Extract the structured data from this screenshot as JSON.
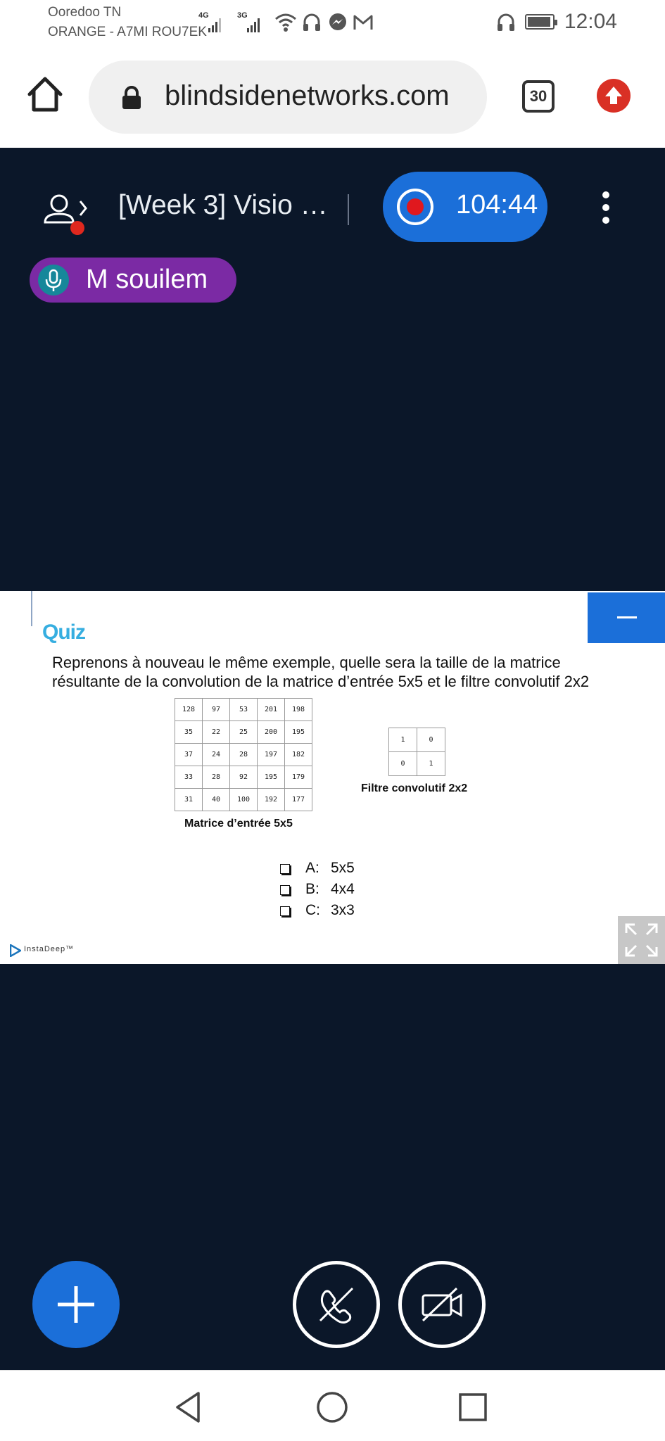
{
  "status_bar": {
    "carrier_line1": "Ooredoo TN",
    "carrier_line2": "ORANGE - A7MI ROU7EK",
    "network1": "4G",
    "network2": "3G",
    "time": "12:04"
  },
  "browser": {
    "url": "blindsidenetworks.com",
    "tab_count": "30"
  },
  "meeting": {
    "title": "[Week 3] Visio …",
    "recording_time": "104:44",
    "speaker_name": "M souilem"
  },
  "slide": {
    "heading": "Quiz",
    "question": "Reprenons à nouveau le même exemple, quelle sera la taille de la matrice résultante de la convolution de la matrice d’entrée 5x5 et le filtre convolutif 2x2",
    "input_matrix": [
      [
        "128",
        "97",
        "53",
        "201",
        "198"
      ],
      [
        "35",
        "22",
        "25",
        "200",
        "195"
      ],
      [
        "37",
        "24",
        "28",
        "197",
        "182"
      ],
      [
        "33",
        "28",
        "92",
        "195",
        "179"
      ],
      [
        "31",
        "40",
        "100",
        "192",
        "177"
      ]
    ],
    "input_matrix_caption": "Matrice d’entrée 5x5",
    "filter_matrix": [
      [
        "1",
        "0"
      ],
      [
        "0",
        "1"
      ]
    ],
    "filter_caption": "Filtre convolutif 2x2",
    "options": [
      {
        "letter": "A:",
        "value": "5x5"
      },
      {
        "letter": "B:",
        "value": "4x4"
      },
      {
        "letter": "C:",
        "value": "3x3"
      }
    ],
    "brand": "InstaDeep™"
  },
  "colors": {
    "meeting_bg": "#0b1729",
    "accent_blue": "#1b6fd9",
    "speaker_purple": "#7b2aa4",
    "record_red": "#e0181e",
    "quiz_blue": "#36aee0"
  }
}
